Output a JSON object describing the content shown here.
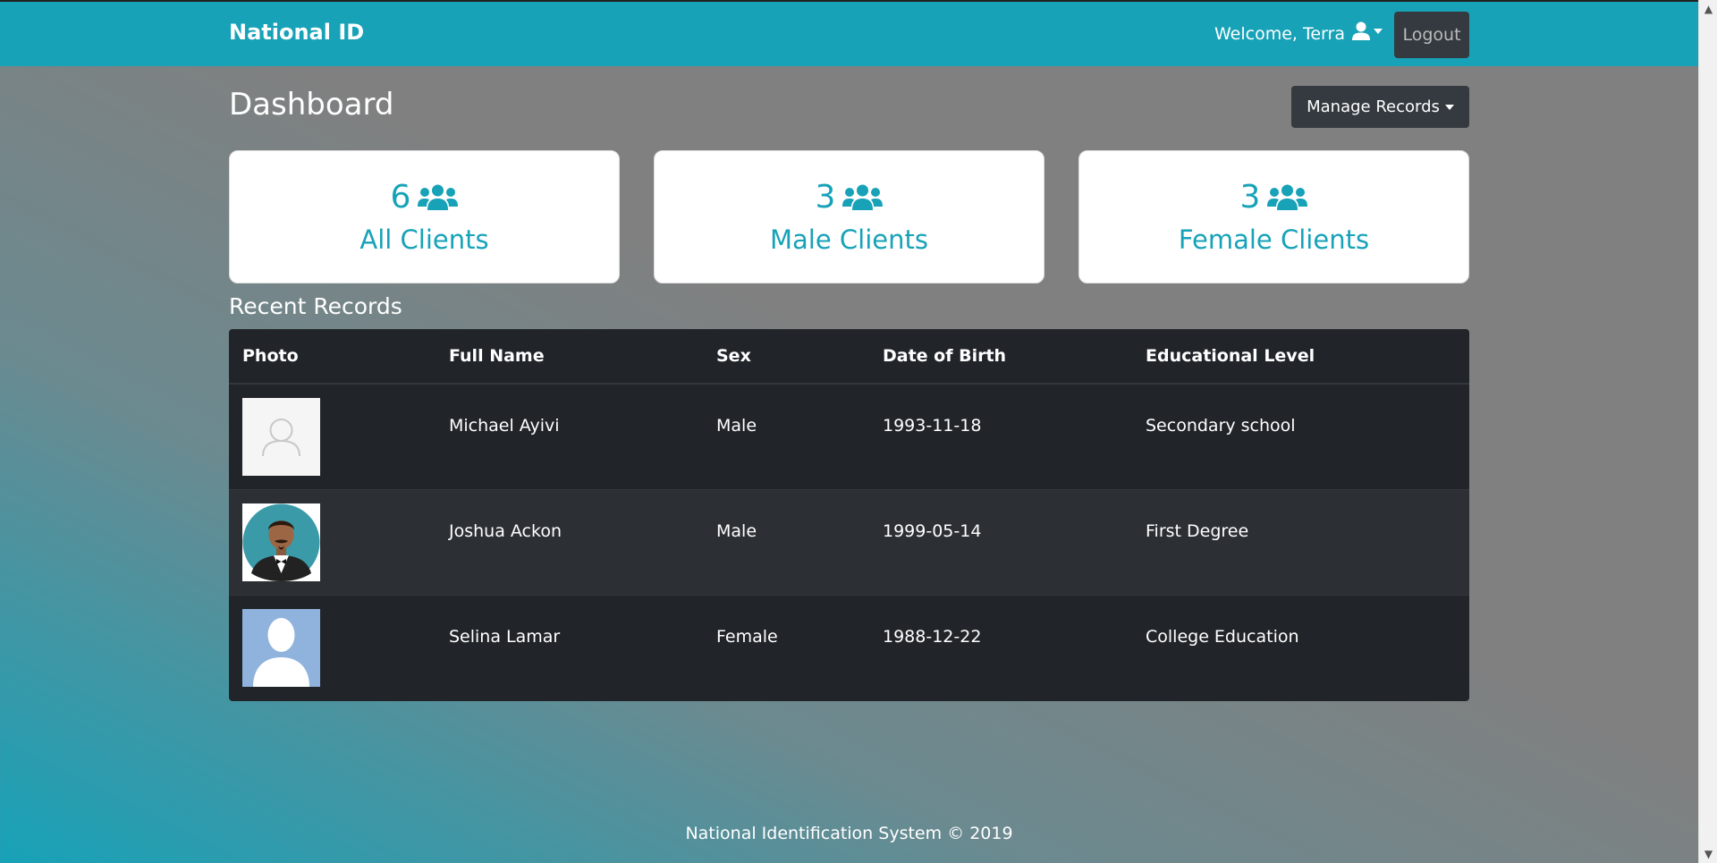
{
  "navbar": {
    "brand": "National ID",
    "welcome": "Welcome, Terra",
    "logout_label": "Logout"
  },
  "header": {
    "title": "Dashboard",
    "manage_label": "Manage Records"
  },
  "stats": [
    {
      "count": "6",
      "label": "All Clients"
    },
    {
      "count": "3",
      "label": "Male Clients"
    },
    {
      "count": "3",
      "label": "Female Clients"
    }
  ],
  "recent": {
    "title": "Recent Records",
    "columns": [
      "Photo",
      "Full Name",
      "Sex",
      "Date of Birth",
      "Educational Level"
    ],
    "rows": [
      {
        "name": "Michael Ayivi",
        "sex": "Male",
        "dob": "1993-11-18",
        "education": "Secondary school",
        "photo": "placeholder-avatar"
      },
      {
        "name": "Joshua Ackon",
        "sex": "Male",
        "dob": "1999-05-14",
        "education": "First Degree",
        "photo": "man-tuxedo-avatar"
      },
      {
        "name": "Selina Lamar",
        "sex": "Female",
        "dob": "1988-12-22",
        "education": "College Education",
        "photo": "silhouette-avatar"
      }
    ]
  },
  "footer": {
    "text": "National Identification System © 2019"
  },
  "colors": {
    "accent": "#17a2b8",
    "dark": "#343a40",
    "table_bg": "#212529"
  }
}
